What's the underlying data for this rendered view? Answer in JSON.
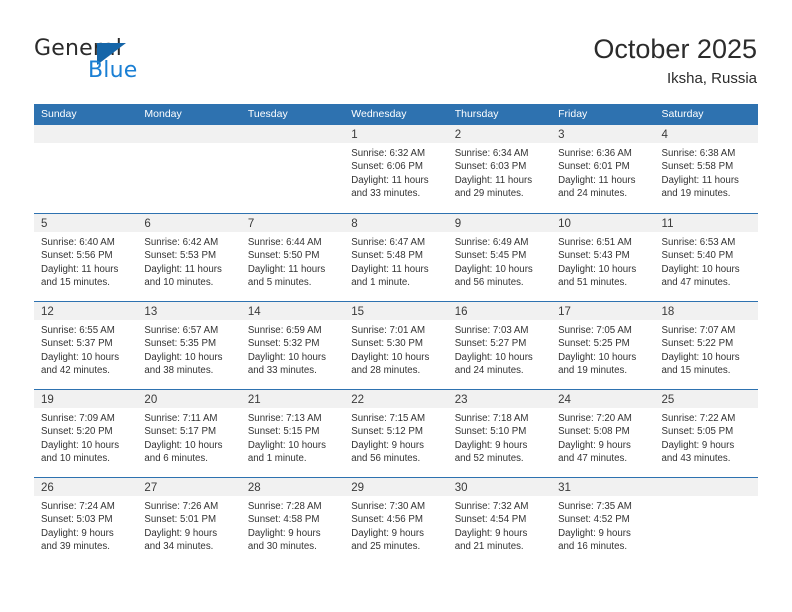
{
  "logo": {
    "word_one": "General",
    "word_two": "Blue",
    "flag_icon": "triangle-flag-icon",
    "brand_blue": "#1a7fd4",
    "flag_blue": "#1565a8"
  },
  "header": {
    "title": "October 2025",
    "subtitle": "Iksha, Russia"
  },
  "theme": {
    "header_band": "#2e72b0",
    "day_band": "#f1f1f1",
    "text": "#333333"
  },
  "weekdays": [
    "Sunday",
    "Monday",
    "Tuesday",
    "Wednesday",
    "Thursday",
    "Friday",
    "Saturday"
  ],
  "weeks": [
    [
      {
        "day": "",
        "lines": []
      },
      {
        "day": "",
        "lines": []
      },
      {
        "day": "",
        "lines": []
      },
      {
        "day": "1",
        "lines": [
          "Sunrise: 6:32 AM",
          "Sunset: 6:06 PM",
          "Daylight: 11 hours",
          "and 33 minutes."
        ]
      },
      {
        "day": "2",
        "lines": [
          "Sunrise: 6:34 AM",
          "Sunset: 6:03 PM",
          "Daylight: 11 hours",
          "and 29 minutes."
        ]
      },
      {
        "day": "3",
        "lines": [
          "Sunrise: 6:36 AM",
          "Sunset: 6:01 PM",
          "Daylight: 11 hours",
          "and 24 minutes."
        ]
      },
      {
        "day": "4",
        "lines": [
          "Sunrise: 6:38 AM",
          "Sunset: 5:58 PM",
          "Daylight: 11 hours",
          "and 19 minutes."
        ]
      }
    ],
    [
      {
        "day": "5",
        "lines": [
          "Sunrise: 6:40 AM",
          "Sunset: 5:56 PM",
          "Daylight: 11 hours",
          "and 15 minutes."
        ]
      },
      {
        "day": "6",
        "lines": [
          "Sunrise: 6:42 AM",
          "Sunset: 5:53 PM",
          "Daylight: 11 hours",
          "and 10 minutes."
        ]
      },
      {
        "day": "7",
        "lines": [
          "Sunrise: 6:44 AM",
          "Sunset: 5:50 PM",
          "Daylight: 11 hours",
          "and 5 minutes."
        ]
      },
      {
        "day": "8",
        "lines": [
          "Sunrise: 6:47 AM",
          "Sunset: 5:48 PM",
          "Daylight: 11 hours",
          "and 1 minute."
        ]
      },
      {
        "day": "9",
        "lines": [
          "Sunrise: 6:49 AM",
          "Sunset: 5:45 PM",
          "Daylight: 10 hours",
          "and 56 minutes."
        ]
      },
      {
        "day": "10",
        "lines": [
          "Sunrise: 6:51 AM",
          "Sunset: 5:43 PM",
          "Daylight: 10 hours",
          "and 51 minutes."
        ]
      },
      {
        "day": "11",
        "lines": [
          "Sunrise: 6:53 AM",
          "Sunset: 5:40 PM",
          "Daylight: 10 hours",
          "and 47 minutes."
        ]
      }
    ],
    [
      {
        "day": "12",
        "lines": [
          "Sunrise: 6:55 AM",
          "Sunset: 5:37 PM",
          "Daylight: 10 hours",
          "and 42 minutes."
        ]
      },
      {
        "day": "13",
        "lines": [
          "Sunrise: 6:57 AM",
          "Sunset: 5:35 PM",
          "Daylight: 10 hours",
          "and 38 minutes."
        ]
      },
      {
        "day": "14",
        "lines": [
          "Sunrise: 6:59 AM",
          "Sunset: 5:32 PM",
          "Daylight: 10 hours",
          "and 33 minutes."
        ]
      },
      {
        "day": "15",
        "lines": [
          "Sunrise: 7:01 AM",
          "Sunset: 5:30 PM",
          "Daylight: 10 hours",
          "and 28 minutes."
        ]
      },
      {
        "day": "16",
        "lines": [
          "Sunrise: 7:03 AM",
          "Sunset: 5:27 PM",
          "Daylight: 10 hours",
          "and 24 minutes."
        ]
      },
      {
        "day": "17",
        "lines": [
          "Sunrise: 7:05 AM",
          "Sunset: 5:25 PM",
          "Daylight: 10 hours",
          "and 19 minutes."
        ]
      },
      {
        "day": "18",
        "lines": [
          "Sunrise: 7:07 AM",
          "Sunset: 5:22 PM",
          "Daylight: 10 hours",
          "and 15 minutes."
        ]
      }
    ],
    [
      {
        "day": "19",
        "lines": [
          "Sunrise: 7:09 AM",
          "Sunset: 5:20 PM",
          "Daylight: 10 hours",
          "and 10 minutes."
        ]
      },
      {
        "day": "20",
        "lines": [
          "Sunrise: 7:11 AM",
          "Sunset: 5:17 PM",
          "Daylight: 10 hours",
          "and 6 minutes."
        ]
      },
      {
        "day": "21",
        "lines": [
          "Sunrise: 7:13 AM",
          "Sunset: 5:15 PM",
          "Daylight: 10 hours",
          "and 1 minute."
        ]
      },
      {
        "day": "22",
        "lines": [
          "Sunrise: 7:15 AM",
          "Sunset: 5:12 PM",
          "Daylight: 9 hours",
          "and 56 minutes."
        ]
      },
      {
        "day": "23",
        "lines": [
          "Sunrise: 7:18 AM",
          "Sunset: 5:10 PM",
          "Daylight: 9 hours",
          "and 52 minutes."
        ]
      },
      {
        "day": "24",
        "lines": [
          "Sunrise: 7:20 AM",
          "Sunset: 5:08 PM",
          "Daylight: 9 hours",
          "and 47 minutes."
        ]
      },
      {
        "day": "25",
        "lines": [
          "Sunrise: 7:22 AM",
          "Sunset: 5:05 PM",
          "Daylight: 9 hours",
          "and 43 minutes."
        ]
      }
    ],
    [
      {
        "day": "26",
        "lines": [
          "Sunrise: 7:24 AM",
          "Sunset: 5:03 PM",
          "Daylight: 9 hours",
          "and 39 minutes."
        ]
      },
      {
        "day": "27",
        "lines": [
          "Sunrise: 7:26 AM",
          "Sunset: 5:01 PM",
          "Daylight: 9 hours",
          "and 34 minutes."
        ]
      },
      {
        "day": "28",
        "lines": [
          "Sunrise: 7:28 AM",
          "Sunset: 4:58 PM",
          "Daylight: 9 hours",
          "and 30 minutes."
        ]
      },
      {
        "day": "29",
        "lines": [
          "Sunrise: 7:30 AM",
          "Sunset: 4:56 PM",
          "Daylight: 9 hours",
          "and 25 minutes."
        ]
      },
      {
        "day": "30",
        "lines": [
          "Sunrise: 7:32 AM",
          "Sunset: 4:54 PM",
          "Daylight: 9 hours",
          "and 21 minutes."
        ]
      },
      {
        "day": "31",
        "lines": [
          "Sunrise: 7:35 AM",
          "Sunset: 4:52 PM",
          "Daylight: 9 hours",
          "and 16 minutes."
        ]
      },
      {
        "day": "",
        "lines": []
      }
    ]
  ]
}
